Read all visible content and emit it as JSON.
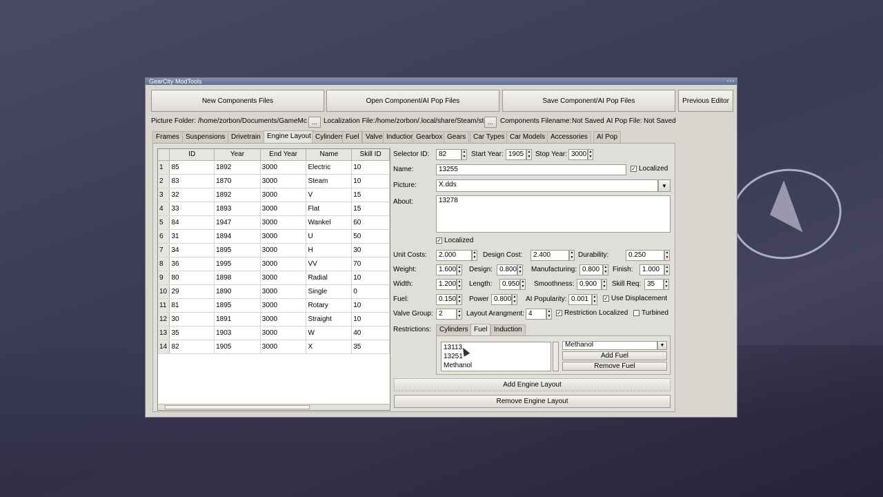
{
  "window": {
    "title": "GearCity ModTools",
    "controls": "▫▫▫"
  },
  "toolbar": {
    "new_components": "New Components Files",
    "open_component": "Open Component/AI Pop Files",
    "save_component": "Save Component/AI Pop Files",
    "previous_editor": "Previous Editor"
  },
  "paths": {
    "picture_label": "Picture Folder:",
    "picture_value": "/home/zorbon/Documents/GameMc",
    "localization_label": "Localization File:",
    "localization_value": "/home/zorbon/.local/share/Steam/ste",
    "components_label": "Components Filename:",
    "components_value": "Not Saved",
    "ai_pop_label": "AI Pop File:",
    "ai_pop_value": "Not Saved",
    "browse": "..."
  },
  "tabs": [
    "Frames",
    "Suspensions",
    "Drivetrain",
    "Engine Layout",
    "Cylinders",
    "Fuel",
    "Valves",
    "Induction",
    "Gearbox",
    "Gears",
    "Car Types",
    "Car Models",
    "Accessories",
    "AI Pop"
  ],
  "active_tab": "Engine Layout",
  "table": {
    "columns": [
      "ID",
      "Year",
      "End Year",
      "Name",
      "Skill ID"
    ],
    "rows": [
      [
        "1",
        "85",
        "1892",
        "3000",
        "Electric",
        "10"
      ],
      [
        "2",
        "83",
        "1870",
        "3000",
        "Steam",
        "10"
      ],
      [
        "3",
        "32",
        "1892",
        "3000",
        "V",
        "15"
      ],
      [
        "4",
        "33",
        "1893",
        "3000",
        "Flat",
        "15"
      ],
      [
        "5",
        "84",
        "1947",
        "3000",
        "Wankel",
        "60"
      ],
      [
        "6",
        "31",
        "1894",
        "3000",
        "U",
        "50"
      ],
      [
        "7",
        "34",
        "1895",
        "3000",
        "H",
        "30"
      ],
      [
        "8",
        "36",
        "1995",
        "3000",
        "VV",
        "70"
      ],
      [
        "9",
        "80",
        "1898",
        "3000",
        "Radial",
        "10"
      ],
      [
        "10",
        "29",
        "1890",
        "3000",
        "Single",
        "0"
      ],
      [
        "11",
        "81",
        "1895",
        "3000",
        "Rotary",
        "10"
      ],
      [
        "12",
        "30",
        "1891",
        "3000",
        "Straight",
        "10"
      ],
      [
        "13",
        "35",
        "1903",
        "3000",
        "W",
        "40"
      ],
      [
        "14",
        "82",
        "1905",
        "3000",
        "X",
        "35"
      ]
    ]
  },
  "form": {
    "selector_id_label": "Selector ID:",
    "selector_id": "82",
    "start_year_label": "Start Year:",
    "start_year": "1905",
    "stop_year_label": "Stop Year:",
    "stop_year": "3000",
    "name_label": "Name:",
    "name": "13255",
    "name_localized": "Localized",
    "picture_label": "Picture:",
    "picture": "X.dds",
    "about_label": "About:",
    "about": "13278",
    "about_localized": "Localized",
    "unit_costs_label": "Unit Costs:",
    "unit_costs": "2.000",
    "design_cost_label": "Design Cost:",
    "design_cost": "2.400",
    "durability_label": "Durability:",
    "durability": "0.250",
    "weight_label": "Weight:",
    "weight": "1.600",
    "design_label": "Design:",
    "design": "0.800",
    "manufacturing_label": "Manufacturing:",
    "manufacturing": "0.800",
    "finish_label": "Finish:",
    "finish": "1.000",
    "width_label": "Width:",
    "width": "1.200",
    "length_label": "Length:",
    "length": "0.950",
    "smoothness_label": "Smoothness:",
    "smoothness": "0.900",
    "skill_req_label": "Skill Req:",
    "skill_req": "35",
    "fuel_label": "Fuel:",
    "fuel": "0.150",
    "power_label": "Power",
    "power": "0.800",
    "ai_popularity_label": "AI Popularity:",
    "ai_popularity": "0.001",
    "use_displacement": "Use Displacement",
    "valve_group_label": "Valve Group:",
    "valve_group": "2",
    "layout_arrangement_label": "Layout Arangment:",
    "layout_arrangement": "4",
    "restriction_localized": "Restriction Localized",
    "turbined": "Turbined",
    "restrictions_label": "Restrictions:",
    "restriction_tabs": [
      "Cylinders",
      "Fuel",
      "Induction"
    ],
    "restriction_active": "Fuel",
    "restriction_list": [
      "13113",
      "13251",
      "Methanol"
    ],
    "fuel_select": "Methanol",
    "add_fuel": "Add Fuel",
    "remove_fuel": "Remove Fuel",
    "add_engine_layout": "Add Engine Layout",
    "remove_engine_layout": "Remove Engine Layout"
  }
}
